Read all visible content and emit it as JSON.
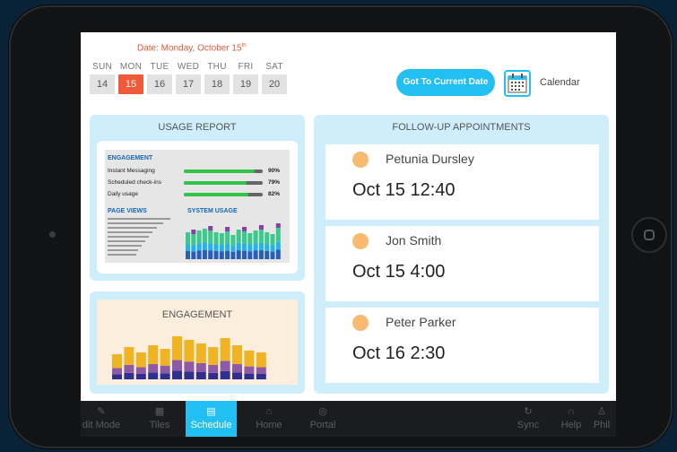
{
  "header": {
    "date_title": "Date: Monday, October 15",
    "date_suffix": "th",
    "days": [
      {
        "name": "SUN",
        "date": "14"
      },
      {
        "name": "MON",
        "date": "15"
      },
      {
        "name": "TUE",
        "date": "16"
      },
      {
        "name": "WED",
        "date": "17"
      },
      {
        "name": "THU",
        "date": "18"
      },
      {
        "name": "FRI",
        "date": "19"
      },
      {
        "name": "SAT",
        "date": "20"
      }
    ],
    "goto_label": "Got To Current Date",
    "calendar_label": "Calendar"
  },
  "usage_report": {
    "title": "USAGE REPORT",
    "engagement_heading": "ENGAGEMENT",
    "metrics": [
      {
        "label": "Instant Messaging",
        "percent": "90%",
        "value": 0.9
      },
      {
        "label": "Scheduled check-ins",
        "percent": "79%",
        "value": 0.79
      },
      {
        "label": "Daily usage",
        "percent": "82%",
        "value": 0.82
      }
    ],
    "page_views_heading": "PAGE VIEWS",
    "system_usage_heading": "SYSTEM USAGE"
  },
  "engagement": {
    "title": "ENGAGEMENT"
  },
  "followup": {
    "title": "FOLLOW-UP APPOINTMENTS",
    "appointments": [
      {
        "name": "Petunia Dursley",
        "time": "Oct 15 12:40"
      },
      {
        "name": "Jon Smith",
        "time": "Oct 15 4:00"
      },
      {
        "name": "Peter Parker",
        "time": "Oct 16 2:30"
      }
    ]
  },
  "nav": {
    "left": [
      {
        "label": "dit Mode",
        "icon": "pencil-icon"
      },
      {
        "label": "Tiles",
        "icon": "tiles-icon"
      },
      {
        "label": "Schedule",
        "icon": "calendar-icon",
        "active": true
      },
      {
        "label": "Home",
        "icon": "home-icon"
      },
      {
        "label": "Portal",
        "icon": "globe-icon"
      }
    ],
    "right": [
      {
        "label": "Sync",
        "icon": "sync-icon"
      },
      {
        "label": "Help",
        "icon": "headset-icon"
      },
      {
        "label": "Phil",
        "icon": "user-icon"
      }
    ]
  },
  "colors": {
    "accent": "#21bff2",
    "active_day": "#ef5a3b",
    "panel_bg": "#cfeefb",
    "appointment_dot": "#f8b970"
  }
}
